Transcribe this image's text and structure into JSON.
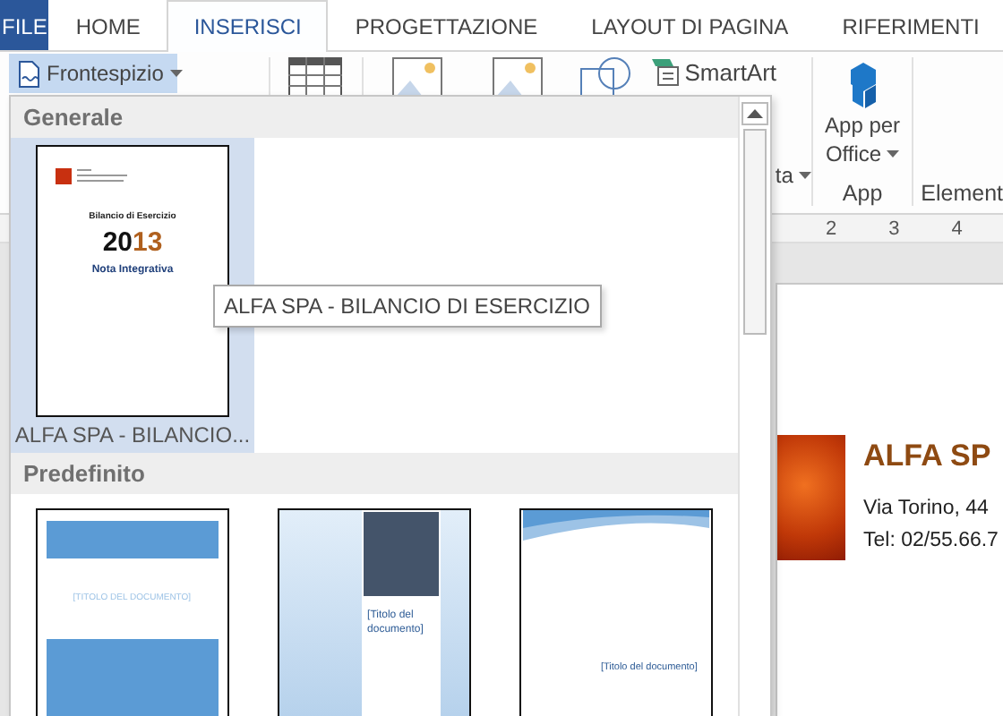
{
  "ribbon_tabs": [
    {
      "label": "FILE",
      "kind": "file",
      "selected": false
    },
    {
      "label": "HOME",
      "kind": "tab",
      "selected": false
    },
    {
      "label": "INSERISCI",
      "kind": "tab",
      "selected": true
    },
    {
      "label": "PROGETTAZIONE",
      "kind": "tab",
      "selected": false
    },
    {
      "label": "LAYOUT DI PAGINA",
      "kind": "tab",
      "selected": false
    },
    {
      "label": "RIFERIMENTI",
      "kind": "tab",
      "selected": false
    }
  ],
  "ribbon": {
    "cover_button": {
      "label": "Frontespizio",
      "pressed": true
    },
    "smartart_button": {
      "label": "SmartArt"
    },
    "cut_button": {
      "label": "ta"
    },
    "app_button": {
      "label_lines": [
        "App per",
        "Office"
      ]
    },
    "groups": [
      {
        "label": "App"
      },
      {
        "label": "Element"
      }
    ]
  },
  "ruler": {
    "numbers": [
      "2",
      "3",
      "4"
    ]
  },
  "document": {
    "company": "ALFA SP",
    "address": "Via Torino, 44",
    "phone": "Tel: 02/55.66.7"
  },
  "gallery": {
    "sections": [
      {
        "title": "Generale",
        "items": [
          {
            "kind": "alfa",
            "label": "ALFA SPA - BILANCIO...",
            "selected": true,
            "preview": {
              "heading": "Bilancio di Esercizio",
              "year_parts": [
                "20",
                "13"
              ],
              "subtitle": "Nota Integrativa"
            }
          }
        ]
      },
      {
        "title": "Predefinito",
        "items": [
          {
            "kind": "banded",
            "selected": false,
            "preview": {
              "title": "[TITOLO DEL DOCUMENTO]"
            }
          },
          {
            "kind": "sidebar",
            "selected": false,
            "preview": {
              "title": "[Titolo del documento]"
            }
          },
          {
            "kind": "wave",
            "selected": false,
            "preview": {
              "title": "[Titolo del documento]"
            }
          }
        ]
      }
    ],
    "tooltip": "ALFA SPA - BILANCIO DI ESERCIZIO"
  }
}
